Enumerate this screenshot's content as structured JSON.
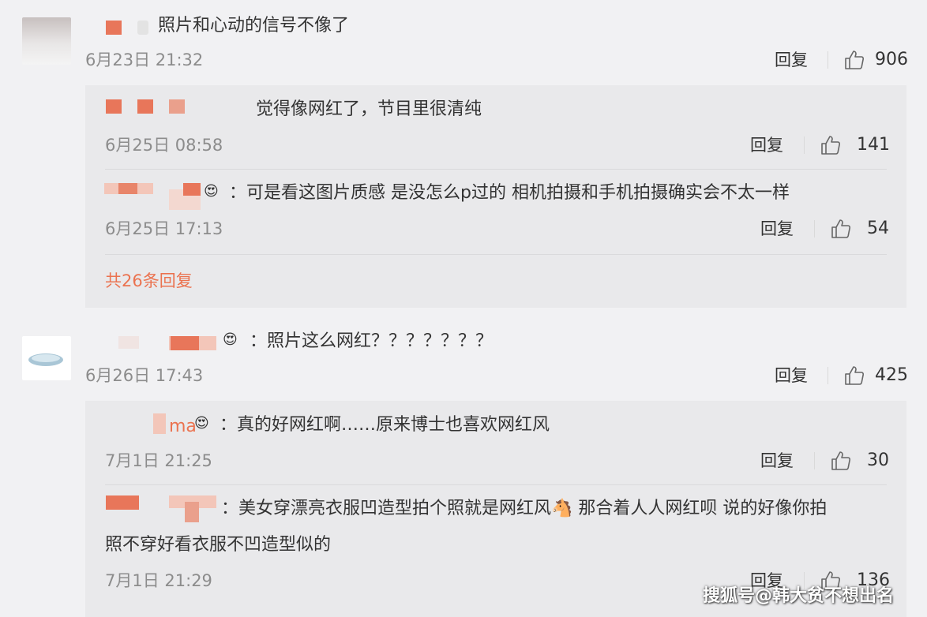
{
  "comments": [
    {
      "text": "照片和心动的信号不像了",
      "time": "6月23日 21:32",
      "reply_label": "回复",
      "likes": "906"
    },
    {
      "text": "：照片这么网红？？？？？？？",
      "time": "6月26日 17:43",
      "reply_label": "回复",
      "likes": "425"
    }
  ],
  "replies_1": [
    {
      "text": "觉得像网红了，节目里很清纯",
      "time": "6月25日 08:58",
      "reply_label": "回复",
      "likes": "141"
    },
    {
      "text": "：可是看这图片质感 是没怎么p过的 相机拍摄和手机拍摄确实会不太一样",
      "time": "6月25日 17:13",
      "reply_label": "回复",
      "likes": "54"
    }
  ],
  "more_replies_1": "共26条回复",
  "replies_2": [
    {
      "name_fragment": "ma",
      "text": "：真的好网红啊……原来博士也喜欢网红风",
      "time": "7月1日 21:25",
      "reply_label": "回复",
      "likes": "30"
    },
    {
      "text_line1": "：美女穿漂亮衣服凹造型拍个照就是网红风🐴 那合着人人网红呗 说的好像你拍",
      "text_line2": "照不穿好看衣服不凹造型似的",
      "time": "7月1日 21:29",
      "reply_label": "回复",
      "likes": "136"
    }
  ],
  "watermark": "搜狐号@韩大贫不想出名",
  "icons": {
    "like": "thumbs-up-icon",
    "crown": "vip-crown-icon"
  },
  "colors": {
    "accent": "#eb7350",
    "background": "#f1f1f3",
    "reply_background": "#e9e9eb"
  }
}
